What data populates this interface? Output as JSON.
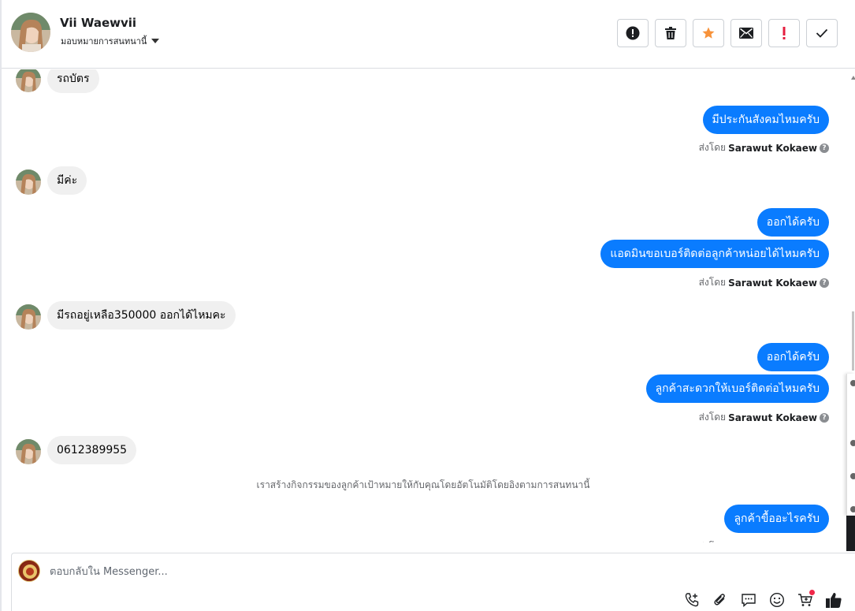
{
  "header": {
    "contact_name": "Vii Waewvii",
    "assign_label": "มอบหมายการสนทนานี้",
    "actions": [
      {
        "name": "spam-icon"
      },
      {
        "name": "trash-icon"
      },
      {
        "name": "star-icon",
        "color": "#f7923a"
      },
      {
        "name": "envelope-icon"
      },
      {
        "name": "important-icon",
        "color": "#e41e3f"
      },
      {
        "name": "checkmark-icon"
      }
    ]
  },
  "messages": {
    "m1": "รถบัตร",
    "m2": "มีประกันสังคมไหมครับ",
    "m3": "มีค่ะ",
    "m4": "ออกได้ครับ",
    "m5": "แอดมินขอเบอร์ติดต่อลูกค้าหน่อยได้ไหมครับ",
    "m6": "มีรถอยู่เหลือ350000 ออกได้ไหมคะ",
    "m7": "ออกได้ครับ",
    "m8": "ลูกค้าสะดวกให้เบอร์ติดต่อไหมครับ",
    "m9": "0612389955",
    "m10": "ลูกค้าขื้ออะไรครับ"
  },
  "sent_by": {
    "prefix": "ส่งโดย",
    "agent": "Sarawut Kokaew"
  },
  "system_note": "เราสร้างกิจกรรมของลูกค้าเป้าหมายให้กับคุณโดยอัตโนมัติโดยอิงตามการสนทนานี้",
  "composer": {
    "placeholder": "ตอบกลับใน Messenger...",
    "tools": [
      "phone-plus-icon",
      "paperclip-icon",
      "chat-bubble-icon",
      "emoji-icon",
      "cart-icon",
      "thumbs-up-icon"
    ]
  },
  "colors": {
    "outgoing_bubble": "#0a7cff",
    "incoming_bubble": "#f0f0f0"
  }
}
